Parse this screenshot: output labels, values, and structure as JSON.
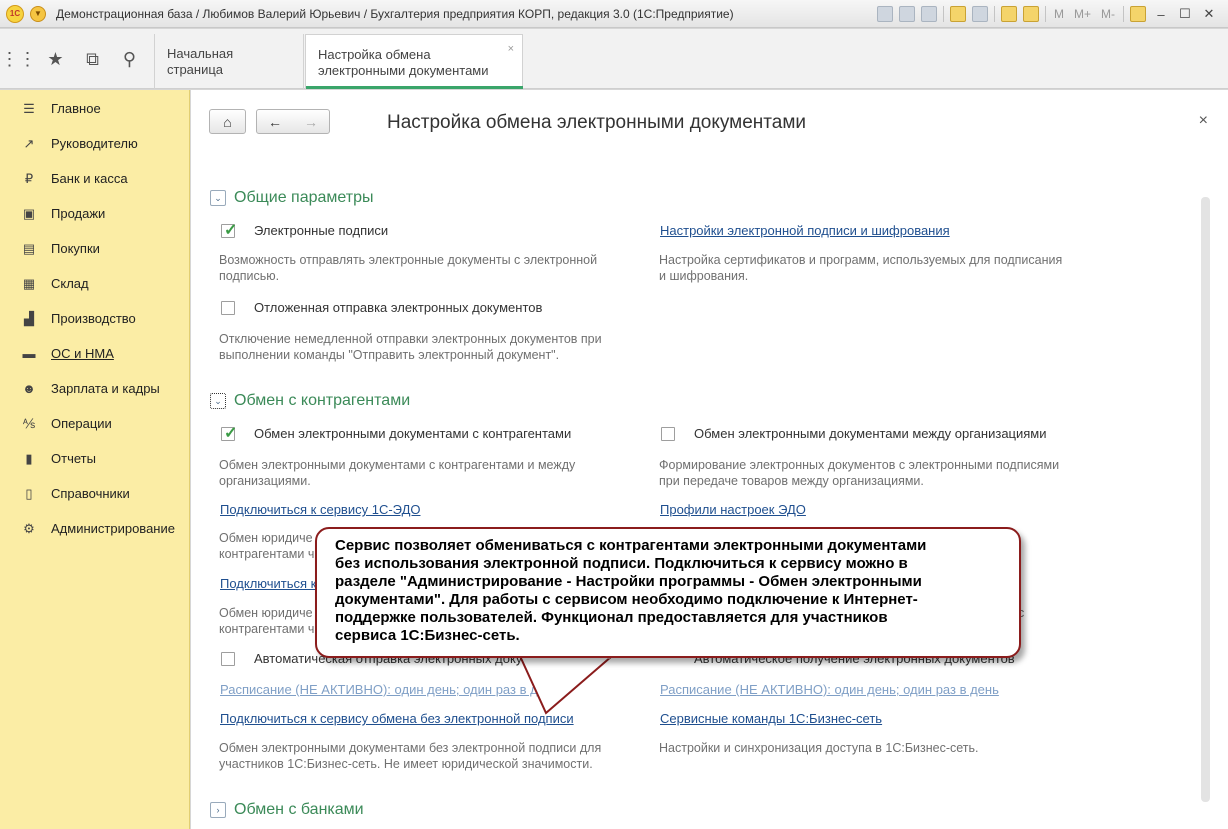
{
  "window": {
    "title": "Демонстрационная база / Любимов Валерий Юрьевич / Бухгалтерия предприятия КОРП, редакция 3.0  (1С:Предприятие)",
    "toolbar_text": [
      "M",
      "M+",
      "M-"
    ]
  },
  "tabs": {
    "home": "Начальная страница",
    "active": "Настройка обмена\nэлектронными документами",
    "close": "×"
  },
  "sidebar": {
    "items": [
      {
        "label": "Главное",
        "icon": "menu-icon"
      },
      {
        "label": "Руководителю",
        "icon": "trend-icon"
      },
      {
        "label": "Банк и касса",
        "icon": "ruble-icon"
      },
      {
        "label": "Продажи",
        "icon": "bag-icon"
      },
      {
        "label": "Покупки",
        "icon": "cart-icon"
      },
      {
        "label": "Склад",
        "icon": "warehouse-icon"
      },
      {
        "label": "Производство",
        "icon": "factory-icon"
      },
      {
        "label": "ОС и НМА",
        "icon": "truck-icon"
      },
      {
        "label": "Зарплата и кадры",
        "icon": "people-icon"
      },
      {
        "label": "Операции",
        "icon": "operations-icon"
      },
      {
        "label": "Отчеты",
        "icon": "bar-chart-icon"
      },
      {
        "label": "Справочники",
        "icon": "book-icon"
      },
      {
        "label": "Администрирование",
        "icon": "gear-icon"
      }
    ]
  },
  "form": {
    "title": "Настройка обмена электронными документами",
    "close": "×",
    "groups": {
      "general": "Общие параметры",
      "counterparties": "Обмен с контрагентами",
      "banks": "Обмен с банками"
    },
    "general": {
      "signatures_label": "Электронные подписи",
      "signatures_checked": true,
      "signatures_desc": "Возможность отправлять электронные документы с электронной\nподписью.",
      "signature_settings_link": "Настройки электронной подписи и шифрования",
      "signature_settings_desc": "Настройка сертификатов и программ, используемых для подписания\nи шифрования.",
      "deferred_label": "Отложенная отправка электронных документов",
      "deferred_checked": false,
      "deferred_desc": "Отключение немедленной отправки электронных документов при\nвыполнении команды \"Отправить электронный документ\"."
    },
    "counterparties": {
      "exchange_label": "Обмен электронными документами с контрагентами",
      "exchange_checked": true,
      "exchange_desc": "Обмен электронными документами с контрагентами и между\nорганизациями.",
      "between_orgs_label": "Обмен электронными документами между организациями",
      "between_orgs_checked": false,
      "between_orgs_desc": "Формирование электронных документов с электронными подписями\nпри передаче товаров между организациями.",
      "connect_edo_link": "Подключиться к сервису 1С-ЭДО",
      "edo_profiles_link": "Профили настроек ЭДО",
      "partial_desc_1": "Обмен юридиче\nконтрагентами ч",
      "partial_link": "Подключиться к",
      "partial_desc_2": "Обмен юридиче\nконтрагентами ч",
      "partial_right": "с",
      "auto_send_label": "Автоматическая отправка электронных документов",
      "auto_send_checked": false,
      "auto_receive_label": "Автоматическое получение электронных документов",
      "schedule_left_link": "Расписание (НЕ АКТИВНО): один день; один раз в день",
      "schedule_right_link": "Расписание (НЕ АКТИВНО): один день; один раз в день",
      "connect_nosign_link": "Подключиться к сервису обмена без электронной подписи",
      "connect_nosign_desc": "Обмен электронными документами без электронной подписи для\nучастников 1С:Бизнес-сеть. Не имеет юридической значимости.",
      "service_commands_link": "Сервисные команды 1С:Бизнес-сеть",
      "service_commands_desc": "Настройки и синхронизация доступа в 1С:Бизнес-сеть."
    }
  },
  "callout": {
    "text": "Сервис позволяет обмениваться с контрагентами электронными документами\nбез использования электронной подписи. Подключиться к сервису можно в\nразделе \"Администрирование - Настройки программы - Обмен электронными\nдокументами\". Для работы с сервисом необходимо подключение к Интернет-\nподдержке пользователей. Функционал предоставляется для участников\nсервиса 1С:Бизнес-сеть."
  },
  "colors": {
    "sidebar_bg": "#fbeda5",
    "group_title": "#3b8a58",
    "link": "#1f4f8f",
    "callout_border": "#8b1c1c",
    "check": "#3a9b45"
  }
}
